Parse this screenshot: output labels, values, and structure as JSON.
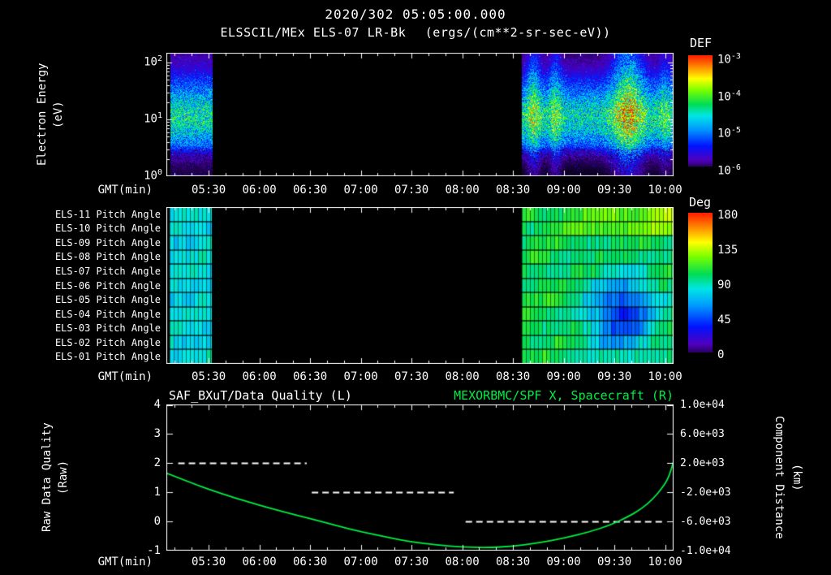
{
  "header": {
    "datetime": "2020/302 05:05:00.000",
    "instrument": "ELSSCIL/MEx ELS-07 LR-Bk",
    "units": "(ergs/(cm**2-sr-sec-eV))"
  },
  "time_axis": {
    "label": "GMT(min)",
    "start_hhmm": "05:05",
    "end_hhmm": "10:05",
    "total_minutes": 300,
    "major_tick_minutes": [
      25,
      55,
      85,
      115,
      145,
      175,
      205,
      235,
      265,
      295
    ],
    "tick_labels": [
      "05:30",
      "06:00",
      "06:30",
      "07:00",
      "07:30",
      "08:00",
      "08:30",
      "09:00",
      "09:30",
      "10:00"
    ]
  },
  "panel1": {
    "ylabel_1": "Electron Energy",
    "ylabel_2": "(eV)",
    "y_ticks": [
      {
        "base": "10",
        "exp": "2",
        "value_ev": 100
      },
      {
        "base": "10",
        "exp": "1",
        "value_ev": 10
      },
      {
        "base": "10",
        "exp": "0",
        "value_ev": 1
      }
    ],
    "colorbar": {
      "title": "DEF",
      "tick_labels": [
        {
          "base": "10",
          "exp": "-3"
        },
        {
          "base": "10",
          "exp": "-4"
        },
        {
          "base": "10",
          "exp": "-5"
        },
        {
          "base": "10",
          "exp": "-6"
        }
      ]
    }
  },
  "panel2": {
    "row_labels": [
      "ELS-11 Pitch Angle",
      "ELS-10 Pitch Angle",
      "ELS-09 Pitch Angle",
      "ELS-08 Pitch Angle",
      "ELS-07 Pitch Angle",
      "ELS-06 Pitch Angle",
      "ELS-05 Pitch Angle",
      "ELS-04 Pitch Angle",
      "ELS-03 Pitch Angle",
      "ELS-02 Pitch Angle",
      "ELS-01 Pitch Angle"
    ],
    "colorbar": {
      "title": "Deg",
      "tick_labels": [
        "180",
        "135",
        "90",
        "45",
        "0"
      ],
      "range_deg": [
        0,
        180
      ]
    }
  },
  "panel3": {
    "left_title": "SAF_BXuT/Data Quality (L)",
    "right_title": "MEXORBMC/SPF X, Spacecraft (R)",
    "left_axis": {
      "label_1": "Raw Data Quality",
      "label_2": "(Raw)",
      "tick_labels": [
        "4",
        "3",
        "2",
        "1",
        "0",
        "-1"
      ],
      "range": [
        -1,
        4
      ]
    },
    "right_axis": {
      "label_1": "Component Distance",
      "label_2": "(km)",
      "tick_labels": [
        "1.0e+04",
        "6.0e+03",
        "2.0e+03",
        "-2.0e+03",
        "-6.0e+03",
        "-1.0e+04"
      ],
      "range_km": [
        -10000,
        10000
      ]
    }
  },
  "colors": {
    "background": "#000000",
    "text": "#ffffff",
    "frame": "#ffffff",
    "accent_green": "#00ee44"
  },
  "chart_data": [
    {
      "type": "heatmap",
      "name": "electron_energy_spectrogram",
      "title": "ELSSCIL/MEx ELS-07 LR-Bk",
      "units": "ergs/(cm**2-sr-sec-eV)",
      "xlabel": "GMT(min)",
      "ylabel": "Electron Energy (eV)",
      "x_start": "05:05",
      "x_end": "10:05",
      "y_scale": "log",
      "ylim_ev": [
        1,
        150
      ],
      "color_scale": "log",
      "color_range_def": [
        1e-06,
        0.001
      ],
      "data_intervals_min": [
        [
          2,
          27
        ],
        [
          210,
          300
        ]
      ],
      "peak_energy_ev": 11,
      "bright_streaks_min": [
        {
          "t": 217,
          "w": 6,
          "boost": 0.22
        },
        {
          "t": 230,
          "w": 5,
          "boost": 0.18
        },
        {
          "t": 273,
          "w": 13,
          "boost": 0.34
        },
        {
          "t": 295,
          "w": 6,
          "boost": 0.12
        }
      ]
    },
    {
      "type": "heatmap",
      "name": "pitch_angle_rows",
      "rows_top_to_bottom": [
        "ELS-11",
        "ELS-10",
        "ELS-09",
        "ELS-08",
        "ELS-07",
        "ELS-06",
        "ELS-05",
        "ELS-04",
        "ELS-03",
        "ELS-02",
        "ELS-01"
      ],
      "value_units": "deg",
      "vlim": [
        0,
        180
      ],
      "data_intervals_min": [
        [
          2,
          27
        ],
        [
          210,
          300
        ]
      ],
      "base_deg_interval1": 85,
      "base_deg_interval2": 105,
      "top_row_warm_deg": 130,
      "blue_blob": {
        "t_center_min": 268,
        "t_sigma_min": 14,
        "row_center_index": 7,
        "row_sigma": 1.9,
        "depth_deg": 62
      },
      "cell_width_min": 2.4
    },
    {
      "type": "line",
      "name": "quality_and_spacecraft_x",
      "xlabel": "GMT(min)",
      "left_ylim": [
        -1,
        4
      ],
      "right_ylim": [
        -10000,
        10000
      ],
      "series": [
        {
          "name": "SAF_BXuT/Data Quality (L)",
          "axis": "left",
          "style": "dashed",
          "color": "#ffffff",
          "steps": [
            {
              "t_min": [
                7,
                83
              ],
              "value": 2
            },
            {
              "t_min": [
                86,
                170
              ],
              "value": 1
            },
            {
              "t_min": [
                177,
                295
              ],
              "value": 0
            }
          ]
        },
        {
          "name": "MEXORBMC/SPF X, Spacecraft (R)",
          "axis": "right",
          "style": "solid",
          "color": "#00ee44",
          "points_min_km": [
            [
              0,
              600
            ],
            [
              15,
              -750
            ],
            [
              25,
              -1600
            ],
            [
              40,
              -2750
            ],
            [
              55,
              -3800
            ],
            [
              70,
              -4750
            ],
            [
              85,
              -5600
            ],
            [
              100,
              -6550
            ],
            [
              115,
              -7400
            ],
            [
              130,
              -8150
            ],
            [
              145,
              -8800
            ],
            [
              160,
              -9250
            ],
            [
              175,
              -9500
            ],
            [
              190,
              -9600
            ],
            [
              205,
              -9400
            ],
            [
              220,
              -8950
            ],
            [
              235,
              -8300
            ],
            [
              250,
              -7450
            ],
            [
              262,
              -6550
            ],
            [
              272,
              -5500
            ],
            [
              281,
              -4300
            ],
            [
              288,
              -2900
            ],
            [
              293,
              -1500
            ],
            [
              297,
              -100
            ],
            [
              300,
              2200
            ]
          ]
        }
      ]
    }
  ]
}
